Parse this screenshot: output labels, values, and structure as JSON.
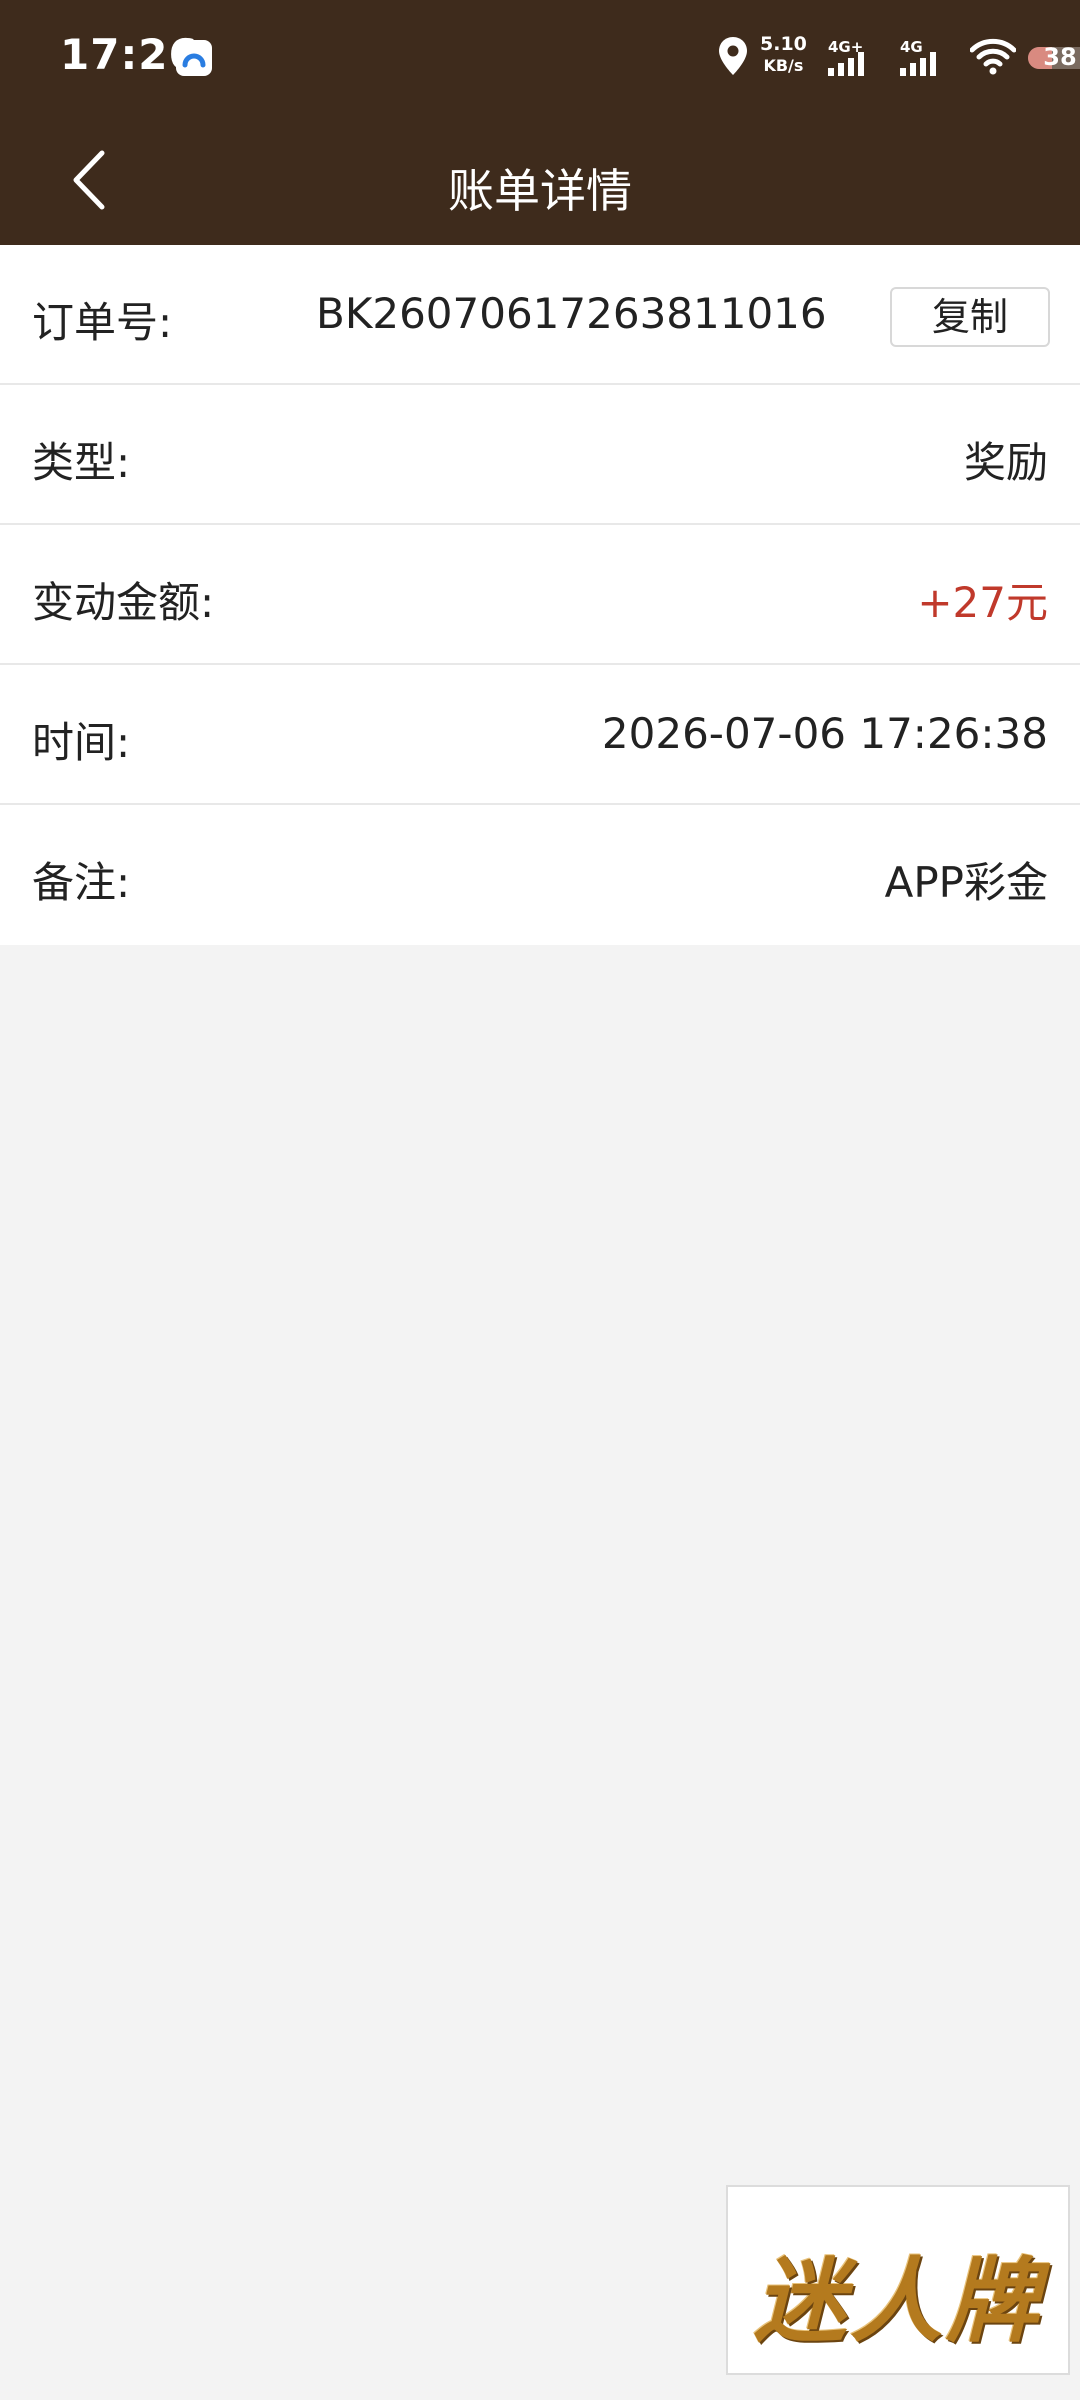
{
  "status_bar": {
    "time": "17:26",
    "net_speed_value": "5.10",
    "net_speed_unit": "KB/s",
    "signal_1": "4G+",
    "signal_2": "4G",
    "battery": "38",
    "battery_fraction": 0.38
  },
  "header": {
    "title": "账单详情"
  },
  "details": {
    "order": {
      "label": "订单号:",
      "value": "BK26070617263811016",
      "copy_label": "复制"
    },
    "type": {
      "label": "类型:",
      "value": "奖励"
    },
    "amount": {
      "label": "变动金额:",
      "value": "+27元",
      "color": "#c0392b"
    },
    "time": {
      "label": "时间:",
      "value": "2026-07-06 17:26:38"
    },
    "remark": {
      "label": "备注:",
      "value": "APP彩金"
    }
  },
  "logo": {
    "text": "迷人牌"
  },
  "colors": {
    "header_bg": "#3e2b1c",
    "page_bg": "#f3f3f3"
  }
}
